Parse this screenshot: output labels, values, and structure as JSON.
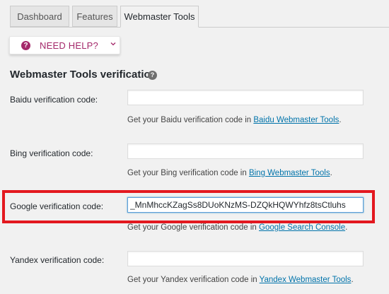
{
  "tabs": [
    {
      "label": "Dashboard"
    },
    {
      "label": "Features"
    },
    {
      "label": "Webmaster Tools"
    }
  ],
  "help_button": {
    "label": "NEED HELP?",
    "icon": "question-circle-icon"
  },
  "section": {
    "title": "Webmaster Tools verification",
    "info_icon": "info-icon"
  },
  "fields": {
    "baidu": {
      "label": "Baidu verification code:",
      "value": "",
      "help_prefix": "Get your Baidu verification code in ",
      "link": "Baidu Webmaster Tools",
      "help_suffix": "."
    },
    "bing": {
      "label": "Bing verification code:",
      "value": "",
      "help_prefix": "Get your Bing verification code in ",
      "link": "Bing Webmaster Tools",
      "help_suffix": "."
    },
    "google": {
      "label": "Google verification code:",
      "value": "_MnMhccKZagSs8DUoKNzMS-DZQkHQWYhfz8tsCtluhs",
      "help_prefix": "Get your Google verification code in ",
      "link": "Google Search Console",
      "help_suffix": "."
    },
    "yandex": {
      "label": "Yandex verification code:",
      "value": "",
      "help_prefix": "Get your Yandex verification code in ",
      "link": "Yandex Webmaster Tools",
      "help_suffix": "."
    }
  },
  "colors": {
    "accent": "#a4286a",
    "link": "#0073aa",
    "highlight": "#e3181f"
  }
}
